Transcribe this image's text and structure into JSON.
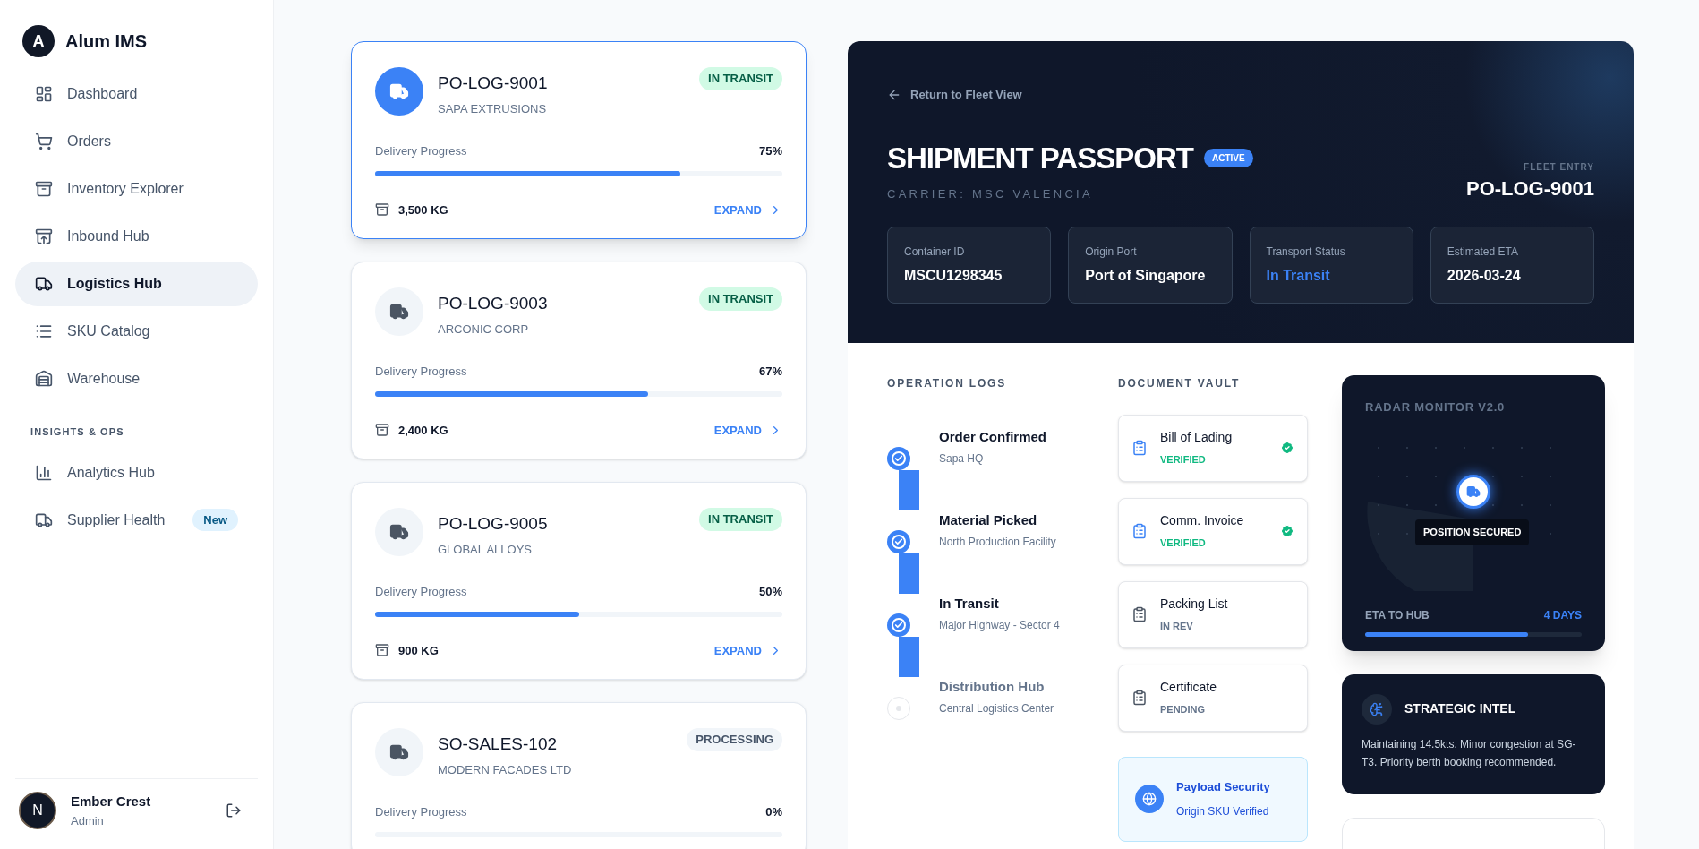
{
  "brand": {
    "letter": "A",
    "name": "Alum IMS"
  },
  "sidebar": {
    "items": [
      {
        "label": "Dashboard",
        "selected": false
      },
      {
        "label": "Orders",
        "selected": false
      },
      {
        "label": "Inventory Explorer",
        "selected": false
      },
      {
        "label": "Inbound Hub",
        "selected": false
      },
      {
        "label": "Logistics Hub",
        "selected": true
      },
      {
        "label": "SKU Catalog",
        "selected": false
      },
      {
        "label": "Warehouse",
        "selected": false
      }
    ],
    "section_label": "INSIGHTS & OPS",
    "section_items": [
      {
        "label": "Analytics Hub",
        "selected": false
      },
      {
        "label": "Supplier Health",
        "selected": false,
        "badge": "New"
      }
    ]
  },
  "user": {
    "initial": "N",
    "name": "Ember Crest",
    "role": "Admin"
  },
  "shipments": [
    {
      "id": "PO-LOG-9001",
      "company": "SAPA EXTRUSIONS",
      "status": "IN TRANSIT",
      "kind": "transit",
      "selected": true,
      "progress_label": "Delivery Progress",
      "percent": "75%",
      "level": 0.75,
      "weight": "3,500 KG",
      "action": "EXPAND"
    },
    {
      "id": "PO-LOG-9003",
      "company": "ARCONIC CORP",
      "status": "IN TRANSIT",
      "kind": "transit",
      "selected": false,
      "progress_label": "Delivery Progress",
      "percent": "67%",
      "level": 0.67,
      "weight": "2,400 KG",
      "action": "EXPAND"
    },
    {
      "id": "PO-LOG-9005",
      "company": "GLOBAL ALLOYS",
      "status": "IN TRANSIT",
      "kind": "transit",
      "selected": false,
      "progress_label": "Delivery Progress",
      "percent": "50%",
      "level": 0.5,
      "weight": "900 KG",
      "action": "EXPAND"
    },
    {
      "id": "SO-SALES-102",
      "company": "MODERN FACADES LTD",
      "status": "PROCESSING",
      "kind": "processing",
      "selected": false,
      "progress_label": "Delivery Progress",
      "percent": "0%",
      "level": 0
    }
  ],
  "passport": {
    "back_link": "Return to Fleet View",
    "title": "SHIPMENT PASSPORT",
    "badge": "ACTIVE",
    "carrier": "CARRIER: MSC VALENCIA",
    "fleet_label": "FLEET ENTRY",
    "fleet_id": "PO-LOG-9001",
    "stats": [
      {
        "label": "Container ID",
        "value": "MSCU1298345",
        "highlight": false
      },
      {
        "label": "Origin Port",
        "value": "Port of Singapore",
        "highlight": false
      },
      {
        "label": "Transport Status",
        "value": "In Transit",
        "highlight": true
      },
      {
        "label": "Estimated ETA",
        "value": "2026-03-24",
        "highlight": false
      }
    ]
  },
  "operation_logs": {
    "title": "OPERATION LOGS",
    "steps": [
      {
        "title": "Order Confirmed",
        "place": "Sapa HQ",
        "done": true
      },
      {
        "title": "Material Picked",
        "place": "North Production Facility",
        "done": true
      },
      {
        "title": "In Transit",
        "place": "Major Highway - Sector 4",
        "done": true
      },
      {
        "title": "Distribution Hub",
        "place": "Central Logistics Center",
        "done": false
      }
    ]
  },
  "document_vault": {
    "title": "DOCUMENT VAULT",
    "documents": [
      {
        "name": "Bill of Lading",
        "status": "VERIFIED",
        "verified": true
      },
      {
        "name": "Comm. Invoice",
        "status": "VERIFIED",
        "verified": true
      },
      {
        "name": "Packing List",
        "status": "IN REV",
        "verified": false
      },
      {
        "name": "Certificate",
        "status": "PENDING",
        "verified": false
      }
    ],
    "security": {
      "title": "Payload Security",
      "subtitle": "Origin SKU Verified"
    }
  },
  "radar": {
    "title": "RADAR MONITOR V2.0",
    "marker_label": "POSITION SECURED",
    "eta_label": "ETA TO HUB",
    "eta_value": "4 DAYS",
    "level": 0.75
  },
  "intel": {
    "title": "STRATEGIC INTEL",
    "text": "Maintaining 14.5kts. Minor congestion at SG-T3. Priority berth booking recommended."
  }
}
